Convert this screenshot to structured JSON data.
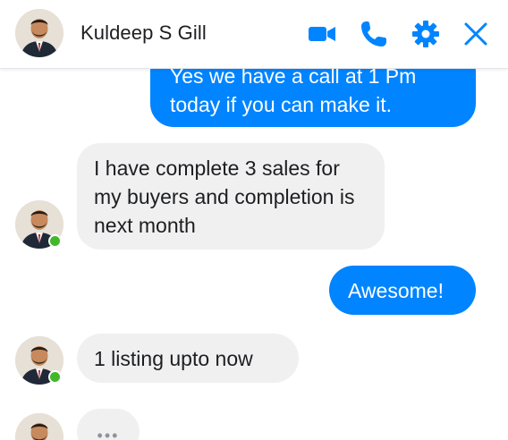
{
  "contact": {
    "name": "Kuldeep S Gill",
    "online": true
  },
  "header": {
    "video_icon": "video-camera-icon",
    "call_icon": "phone-icon",
    "settings_icon": "gear-icon",
    "close_icon": "close-icon"
  },
  "colors": {
    "accent": "#0084ff",
    "incoming_bubble": "#f1f0f0",
    "presence": "#42b72a"
  },
  "messages": [
    {
      "direction": "outgoing",
      "text": "Yes we have a call at 1 Pm today if you can make it."
    },
    {
      "direction": "incoming",
      "text": "I have complete 3 sales for my buyers and completion is next month"
    },
    {
      "direction": "outgoing",
      "text": "Awesome!"
    },
    {
      "direction": "incoming",
      "text": "1 listing upto now"
    },
    {
      "direction": "incoming",
      "typing": true,
      "text": "•••"
    }
  ]
}
